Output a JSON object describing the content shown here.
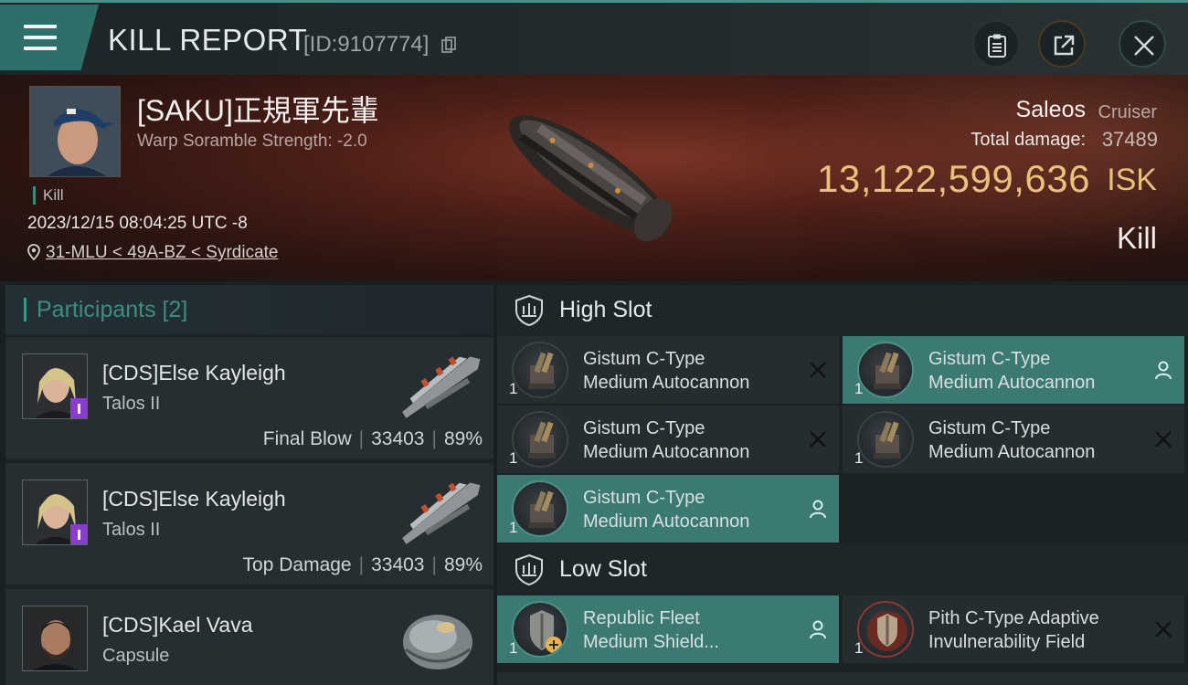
{
  "header": {
    "title": "KILL REPORT",
    "report_id": "[ID:9107774]"
  },
  "victim": {
    "name": "[SAKU]正規軍先輩",
    "warp_strength": "Warp Soramble Strength: -2.0",
    "tag": "Kill",
    "datetime": "2023/12/15 08:04:25 UTC -8",
    "location": "31-MLU < 49A-BZ < Syrdicate",
    "ship_name": "Saleos",
    "ship_class": "Cruiser",
    "total_damage_label": "Total damage:",
    "total_damage": "37489",
    "isk_value": "13,122,599,636",
    "isk_unit": "ISK",
    "result": "Kill"
  },
  "participants": {
    "header": "Participants [2]",
    "rows": [
      {
        "name": "[CDS]Else Kayleigh",
        "ship": "Talos II",
        "role": "Final Blow",
        "damage": "33403",
        "percent": "89%"
      },
      {
        "name": "[CDS]Else Kayleigh",
        "ship": "Talos II",
        "role": "Top Damage",
        "damage": "33403",
        "percent": "89%"
      },
      {
        "name": "[CDS]Kael Vava",
        "ship": "Capsule"
      }
    ]
  },
  "fitting": {
    "high_slot_label": "High Slot",
    "low_slot_label": "Low Slot",
    "high_slots": [
      {
        "line1": "Gistum C-Type",
        "line2": "Medium Autocannon",
        "qty": "1",
        "state": "destroyed"
      },
      {
        "line1": "Gistum C-Type",
        "line2": "Medium Autocannon",
        "qty": "1",
        "state": "dropped"
      },
      {
        "line1": "Gistum C-Type",
        "line2": "Medium Autocannon",
        "qty": "1",
        "state": "destroyed"
      },
      {
        "line1": "Gistum C-Type",
        "line2": "Medium Autocannon",
        "qty": "1",
        "state": "destroyed"
      },
      {
        "line1": "Gistum C-Type",
        "line2": "Medium Autocannon",
        "qty": "1",
        "state": "dropped"
      }
    ],
    "low_slots": [
      {
        "line1": "Republic Fleet",
        "line2": "Medium Shield...",
        "qty": "1",
        "state": "dropped"
      },
      {
        "line1": "Pith C-Type Adaptive",
        "line2": "Invulnerability Field",
        "qty": "1",
        "state": "destroyed"
      }
    ]
  },
  "colors": {
    "accent_teal": "#3b7a73",
    "isk_gold": "#e9c17a",
    "purple_badge": "#8a3ccf"
  },
  "icons": [
    "menu-icon",
    "copy-icon",
    "clipboard-icon",
    "share-icon",
    "close-icon",
    "location-pin-icon",
    "shield-slot-icon",
    "destroyed-x-icon",
    "dropped-person-icon"
  ]
}
